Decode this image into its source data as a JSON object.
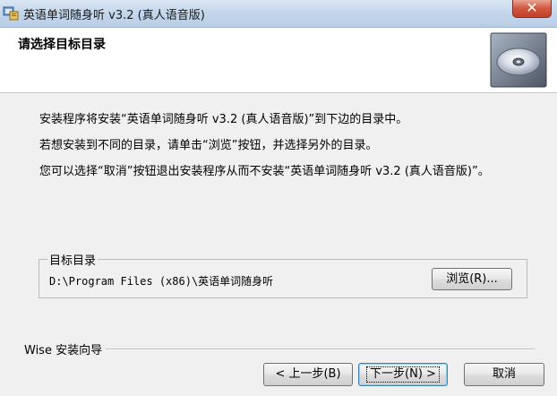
{
  "window": {
    "title": "英语单词随身听  v3.2 (真人语音版)",
    "close_label": "✕"
  },
  "header": {
    "title": "请选择目标目录"
  },
  "body": {
    "line1": "安装程序将安装“英语单词随身听  v3.2 (真人语音版)”到下边的目录中。",
    "line2": "若想安装到不同的目录，请单击“浏览”按钮，并选择另外的目录。",
    "line3": "您可以选择“取消”按钮退出安装程序从而不安装“英语单词随身听  v3.2 (真人语音版)”。"
  },
  "destination": {
    "group_label": "目标目录",
    "path": "D:\\Program Files (x86)\\英语单词随身听",
    "browse_label": "浏览(R)..."
  },
  "footer": {
    "brand": "Wise 安装向导",
    "back_label": "< 上一步(B)",
    "next_label": "下一步(N) >",
    "cancel_label": "取消"
  }
}
